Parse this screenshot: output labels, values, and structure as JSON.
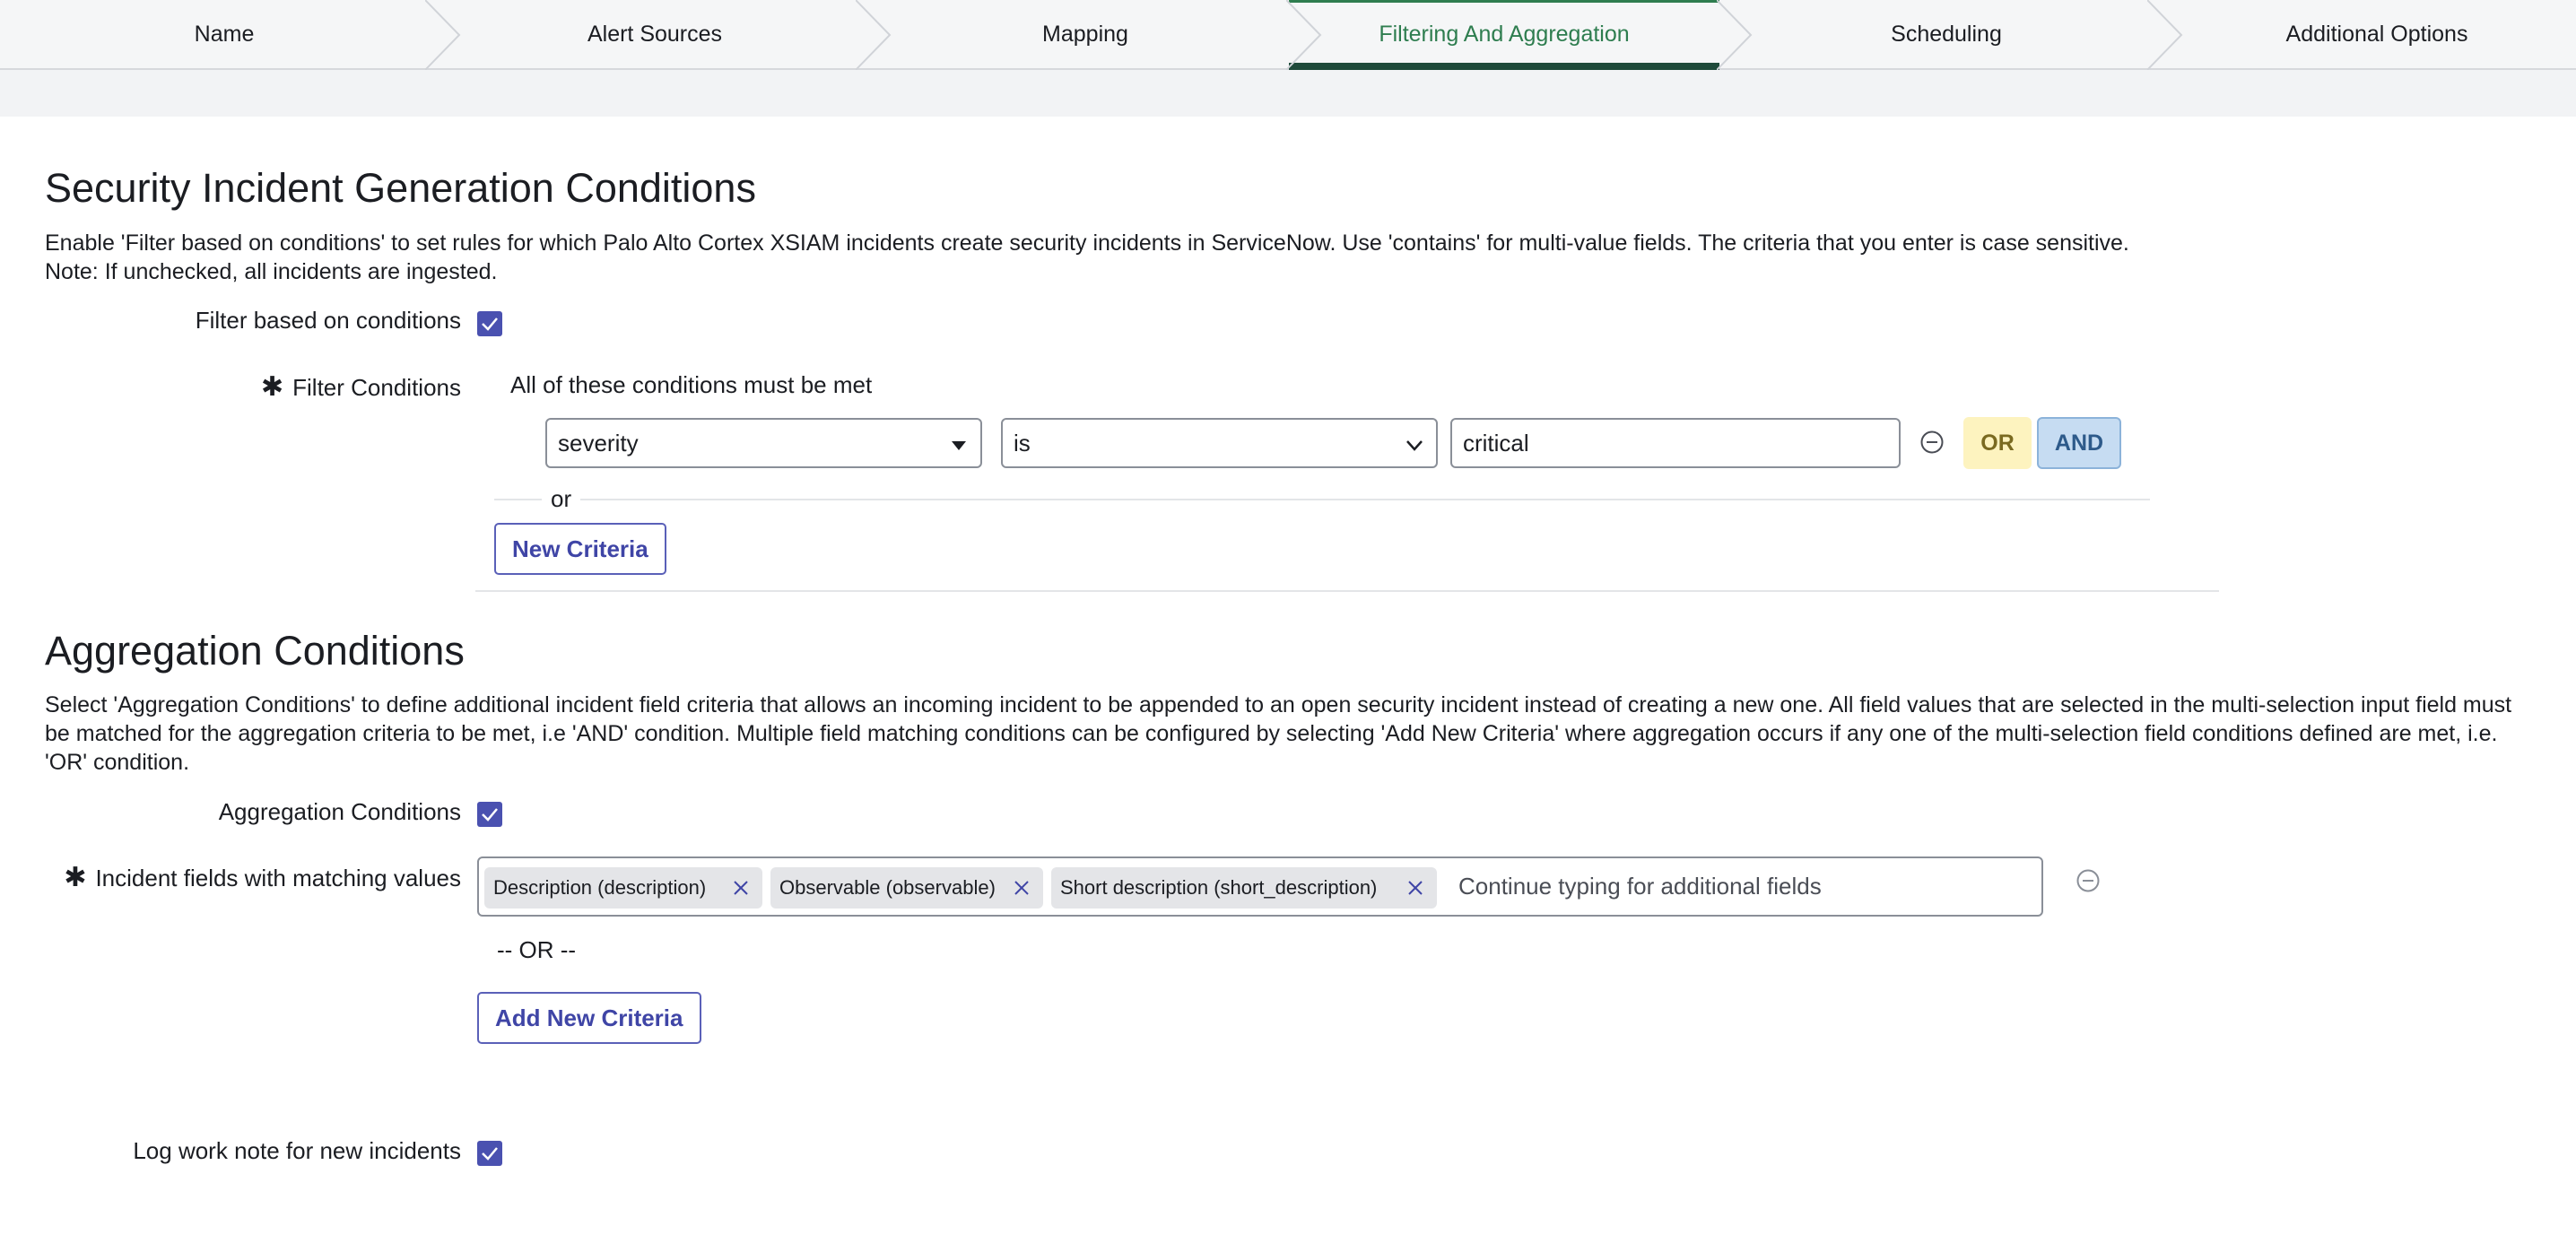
{
  "wizard": {
    "steps": [
      {
        "label": "Name"
      },
      {
        "label": "Alert Sources"
      },
      {
        "label": "Mapping"
      },
      {
        "label": "Filtering And Aggregation"
      },
      {
        "label": "Scheduling"
      },
      {
        "label": "Additional Options"
      }
    ],
    "active_step": "Filtering And Aggregation"
  },
  "security_section": {
    "title": "Security Incident Generation Conditions",
    "description_line1": "Enable 'Filter based on conditions' to set rules for which Palo Alto Cortex XSIAM incidents create security incidents in ServiceNow. Use 'contains' for multi-value fields. The criteria that you enter is case sensitive.",
    "description_line2": "Note: If unchecked, all incidents are ingested.",
    "filter_checkbox_label": "Filter based on conditions",
    "filter_checkbox_checked": true,
    "filter_conditions_label": "Filter Conditions",
    "all_conditions_text": "All of these conditions must be met",
    "condition": {
      "field": "severity",
      "operator": "is",
      "value": "critical"
    },
    "or_button": "OR",
    "and_button": "AND",
    "or_separator": "or",
    "new_criteria_button": "New Criteria"
  },
  "aggregation_section": {
    "title": "Aggregation Conditions",
    "description": "Select 'Aggregation Conditions' to define additional incident field criteria that allows an incoming incident to be appended to an open security incident instead of creating a new one. All field values that are selected in the multi-selection input field must be matched for the aggregation criteria to be met, i.e 'AND' condition. Multiple field matching conditions can be configured by selecting 'Add New Criteria' where aggregation occurs if any one of the multi-selection field conditions defined are met, i.e. 'OR' condition.",
    "aggregation_checkbox_label": "Aggregation Conditions",
    "aggregation_checkbox_checked": true,
    "matching_fields_label": "Incident fields with matching values",
    "tags": [
      {
        "label": "Description (description)"
      },
      {
        "label": "Observable (observable)"
      },
      {
        "label": "Short description (short_description)"
      }
    ],
    "tags_placeholder": "Continue typing for additional fields",
    "or_divider": "-- OR --",
    "add_new_criteria_button": "Add New Criteria"
  },
  "worknote": {
    "label": "Log work note for new incidents",
    "checked": true
  },
  "colors": {
    "accent_purple": "#4a51b0",
    "active_step_green": "#2e7d4f",
    "or_bg": "#fdf3bf",
    "and_bg": "#c6dcf2"
  }
}
